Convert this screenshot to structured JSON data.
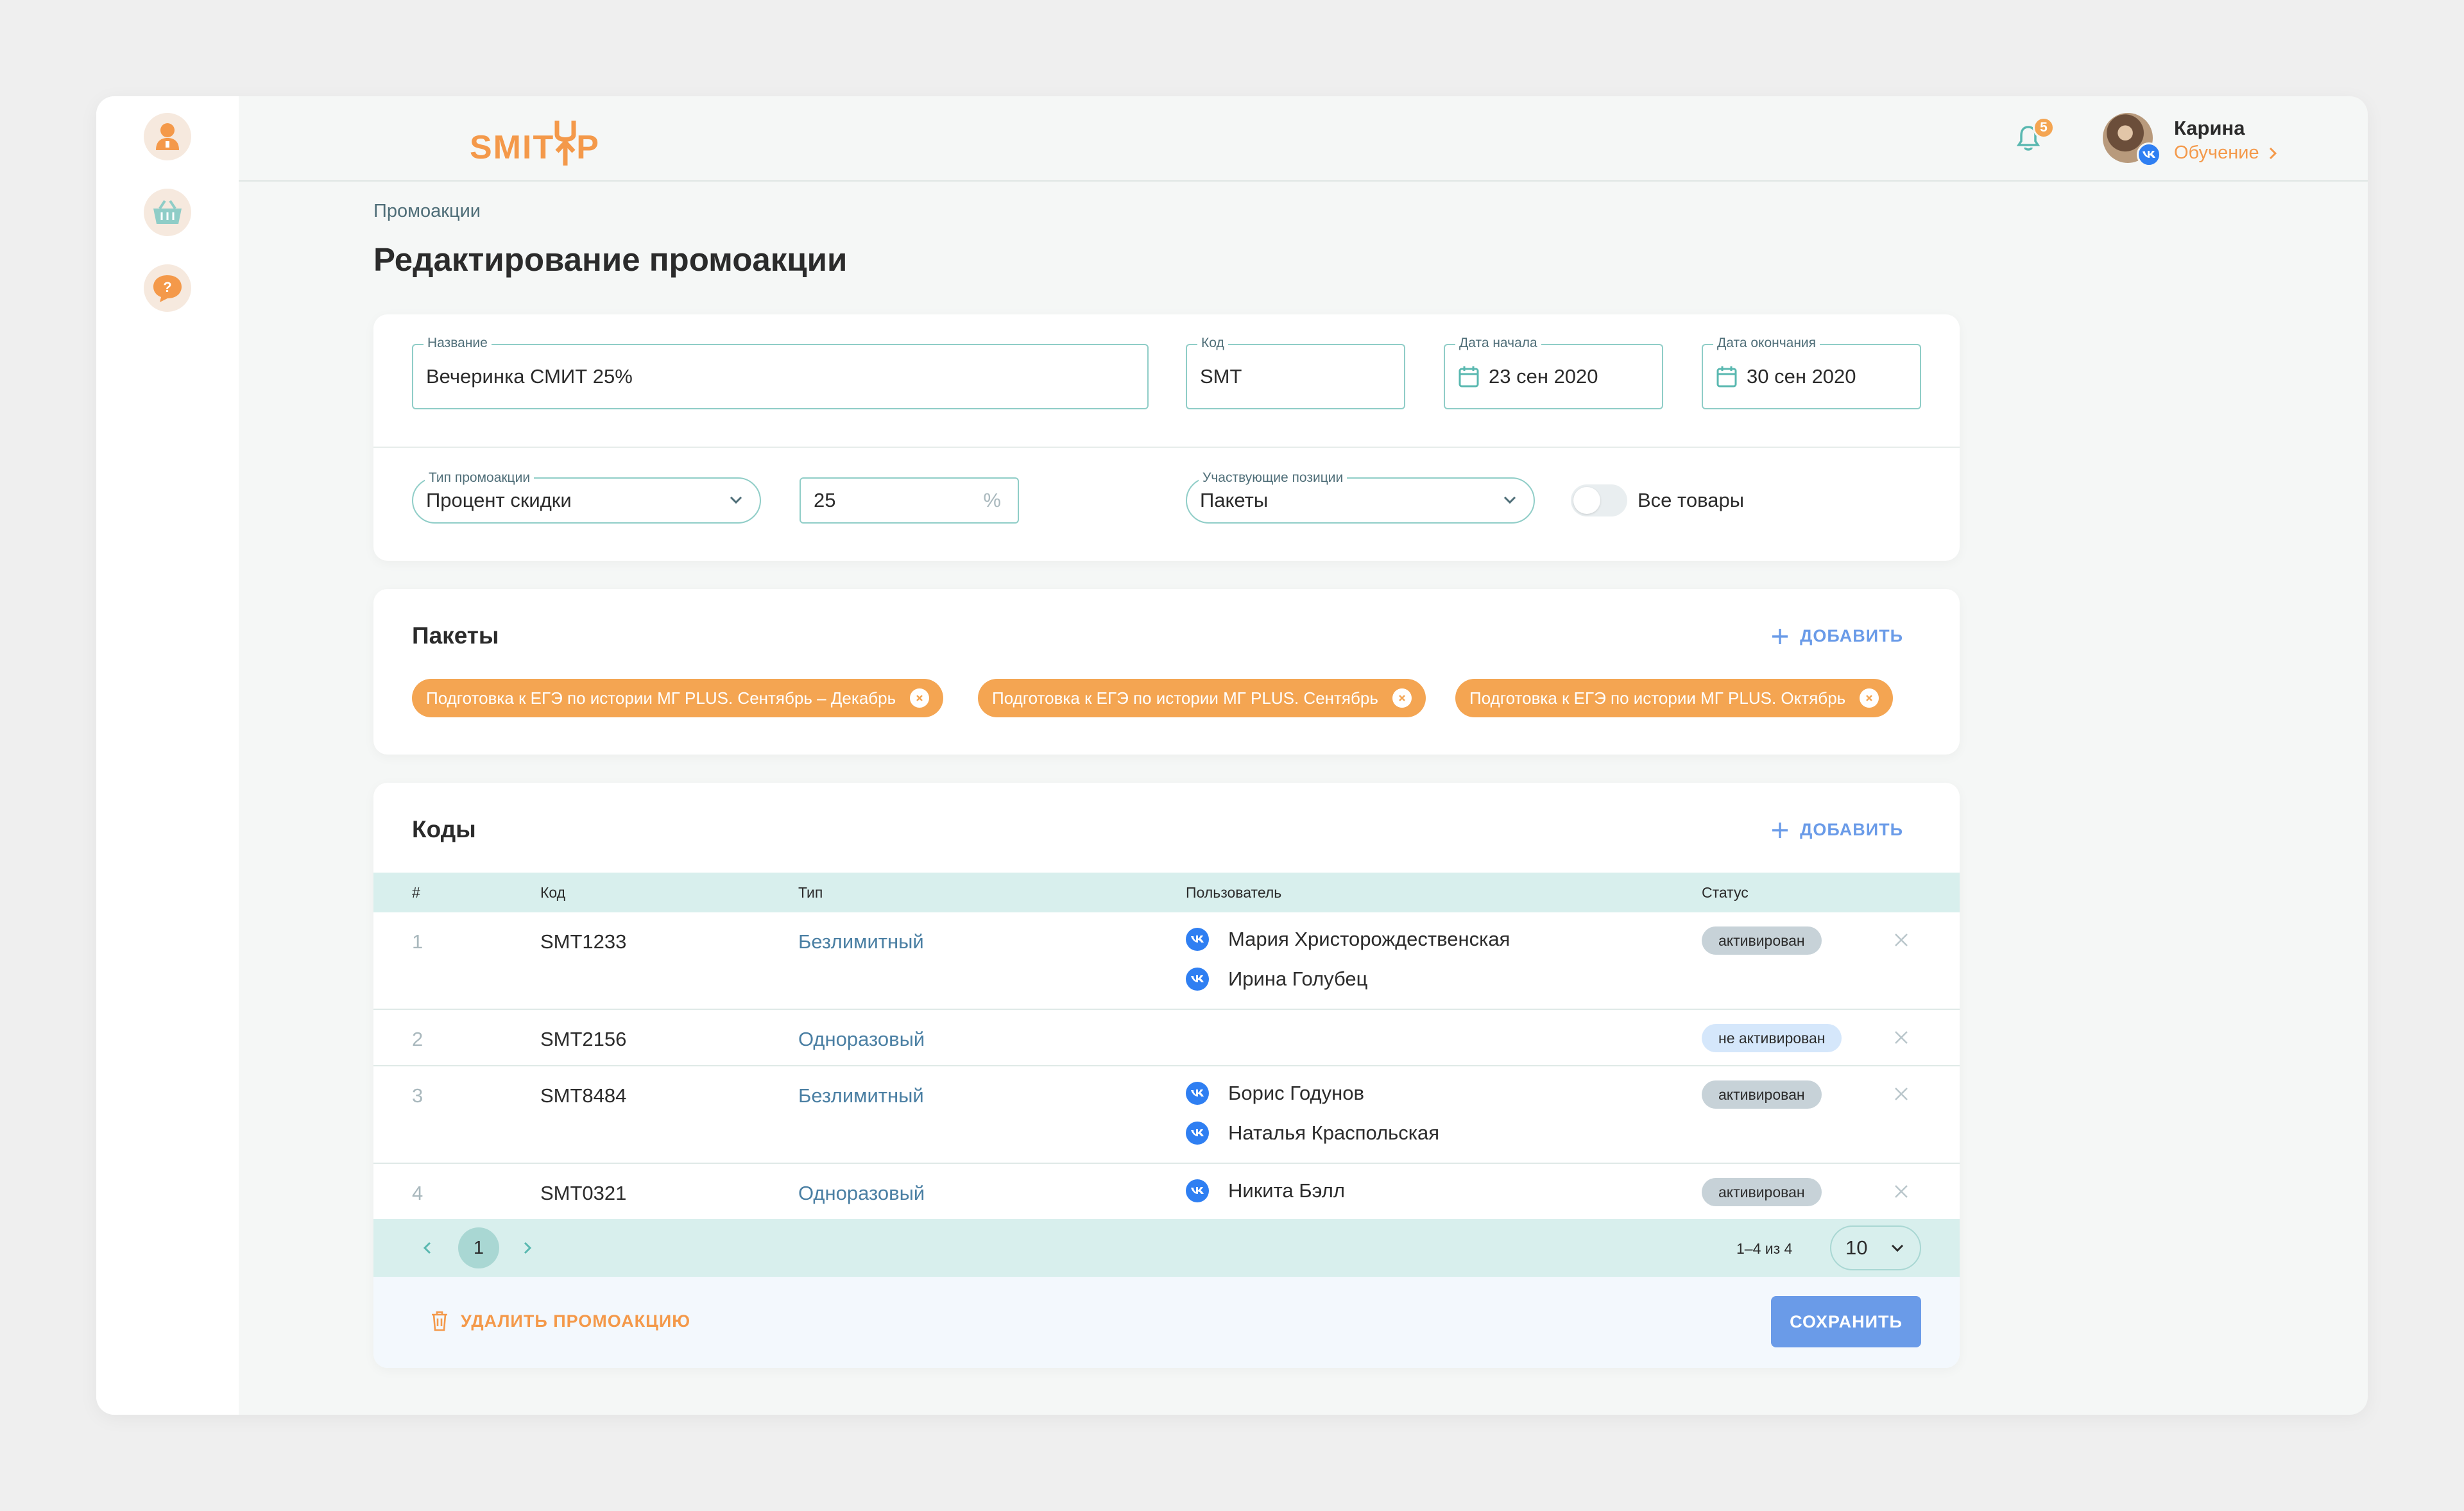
{
  "header": {
    "logo_text_left": "SMIT",
    "logo_text_right": "P",
    "notifications_count": "5",
    "user_name": "Карина",
    "user_link": "Обучение"
  },
  "breadcrumb": "Промоакции",
  "page_title": "Редактирование промоакции",
  "form": {
    "name": {
      "label": "Название",
      "value": "Вечеринка СМИТ 25%"
    },
    "code": {
      "label": "Код",
      "value": "SMT"
    },
    "start_date": {
      "label": "Дата начала",
      "value": "23 сен 2020"
    },
    "end_date": {
      "label": "Дата окончания",
      "value": "30 сен 2020"
    },
    "promo_type": {
      "label": "Тип промоакции",
      "value": "Процент скидки"
    },
    "discount": {
      "value": "25",
      "unit": "%"
    },
    "positions": {
      "label": "Участвующие позиции",
      "value": "Пакеты"
    },
    "all_goods": {
      "label": "Все товары",
      "checked": false
    }
  },
  "packages": {
    "title": "Пакеты",
    "add_label": "ДОБАВИТЬ",
    "chips": [
      "Подготовка к ЕГЭ по истории МГ PLUS. Сентябрь – Декабрь",
      "Подготовка к ЕГЭ по истории МГ PLUS. Сентябрь",
      "Подготовка к ЕГЭ по истории МГ PLUS. Октябрь"
    ]
  },
  "codes": {
    "title": "Коды",
    "add_label": "ДОБАВИТЬ",
    "columns": [
      "#",
      "Код",
      "Тип",
      "Пользователь",
      "Статус"
    ],
    "rows": [
      {
        "num": "1",
        "code": "SMT1233",
        "type": "Безлимитный",
        "users": [
          "Мария Христорождественская",
          "Ирина Голубец"
        ],
        "status": "активирован"
      },
      {
        "num": "2",
        "code": "SMT2156",
        "type": "Одноразовый",
        "users": [],
        "status": "не активирован"
      },
      {
        "num": "3",
        "code": "SMT8484",
        "type": "Безлимитный",
        "users": [
          "Борис Годунов",
          "Наталья Краспольская"
        ],
        "status": "активирован"
      },
      {
        "num": "4",
        "code": "SMT0321",
        "type": "Одноразовый",
        "users": [
          "Никита Бэлл"
        ],
        "status": "активирован"
      }
    ],
    "pagination": {
      "current_page": "1",
      "range": "1–4 из 4",
      "page_size": "10"
    }
  },
  "actions": {
    "delete_label": "УДАЛИТЬ ПРОМОАКЦИЮ",
    "save_label": "СОХРАНИТЬ"
  },
  "colors": {
    "accent_orange": "#f4994a",
    "chip_orange": "#f4a552",
    "teal_border": "#8fcdc7",
    "table_header": "#d8efed",
    "primary_blue": "#6a9be8",
    "vk_blue": "#2f7ff2"
  }
}
